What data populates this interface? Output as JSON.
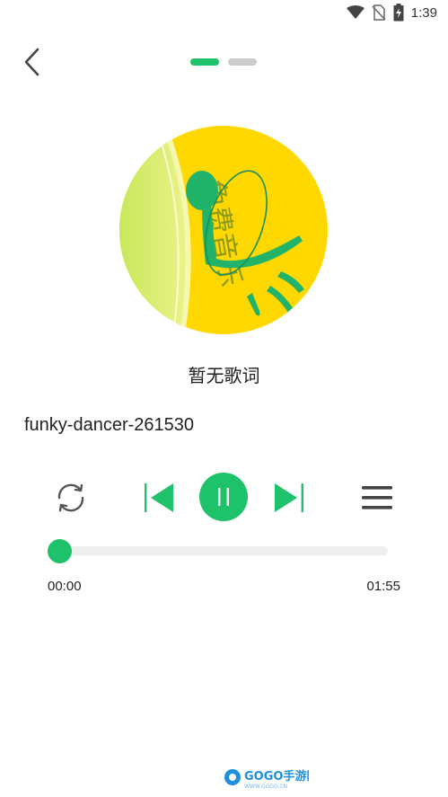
{
  "status_bar": {
    "time": "1:39",
    "icons": [
      "wifi-icon",
      "no-sim-icon",
      "battery-charging-icon"
    ]
  },
  "header": {
    "back_icon": "chevron-left-icon",
    "pager": {
      "count": 2,
      "active_index": 0
    }
  },
  "album_art": {
    "icon": "music-note-logo",
    "text": "免费音乐"
  },
  "lyrics_text": "暂无歌词",
  "song_title": "funky-dancer-261530",
  "controls": {
    "repeat_icon": "repeat-icon",
    "prev_icon": "skip-previous-icon",
    "play_icon": "pause-icon",
    "next_icon": "skip-next-icon",
    "playlist_icon": "playlist-menu-icon"
  },
  "progress": {
    "current_time": "00:00",
    "total_time": "01:55",
    "fraction": 0.0
  },
  "watermark": {
    "brand": "GOGO手游网",
    "url": "WWW.GOGO.CN"
  },
  "colors": {
    "accent": "#1ec26a",
    "inactive": "#cccccc",
    "text": "#222222",
    "track": "#eeeeee"
  }
}
